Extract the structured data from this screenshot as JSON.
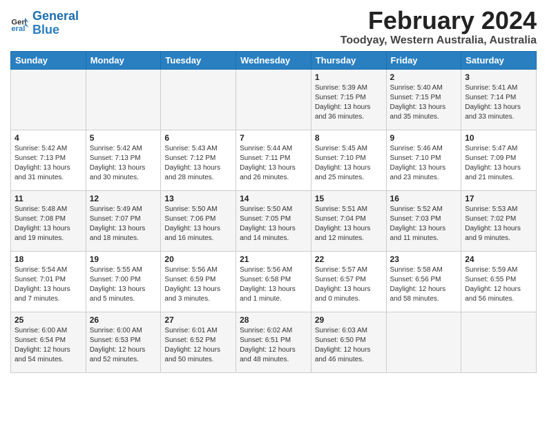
{
  "logo": {
    "text_general": "General",
    "text_blue": "Blue"
  },
  "title": "February 2024",
  "location": "Toodyay, Western Australia, Australia",
  "headers": [
    "Sunday",
    "Monday",
    "Tuesday",
    "Wednesday",
    "Thursday",
    "Friday",
    "Saturday"
  ],
  "weeks": [
    [
      {
        "day": "",
        "content": ""
      },
      {
        "day": "",
        "content": ""
      },
      {
        "day": "",
        "content": ""
      },
      {
        "day": "",
        "content": ""
      },
      {
        "day": "1",
        "content": "Sunrise: 5:39 AM\nSunset: 7:15 PM\nDaylight: 13 hours\nand 36 minutes."
      },
      {
        "day": "2",
        "content": "Sunrise: 5:40 AM\nSunset: 7:15 PM\nDaylight: 13 hours\nand 35 minutes."
      },
      {
        "day": "3",
        "content": "Sunrise: 5:41 AM\nSunset: 7:14 PM\nDaylight: 13 hours\nand 33 minutes."
      }
    ],
    [
      {
        "day": "4",
        "content": "Sunrise: 5:42 AM\nSunset: 7:13 PM\nDaylight: 13 hours\nand 31 minutes."
      },
      {
        "day": "5",
        "content": "Sunrise: 5:42 AM\nSunset: 7:13 PM\nDaylight: 13 hours\nand 30 minutes."
      },
      {
        "day": "6",
        "content": "Sunrise: 5:43 AM\nSunset: 7:12 PM\nDaylight: 13 hours\nand 28 minutes."
      },
      {
        "day": "7",
        "content": "Sunrise: 5:44 AM\nSunset: 7:11 PM\nDaylight: 13 hours\nand 26 minutes."
      },
      {
        "day": "8",
        "content": "Sunrise: 5:45 AM\nSunset: 7:10 PM\nDaylight: 13 hours\nand 25 minutes."
      },
      {
        "day": "9",
        "content": "Sunrise: 5:46 AM\nSunset: 7:10 PM\nDaylight: 13 hours\nand 23 minutes."
      },
      {
        "day": "10",
        "content": "Sunrise: 5:47 AM\nSunset: 7:09 PM\nDaylight: 13 hours\nand 21 minutes."
      }
    ],
    [
      {
        "day": "11",
        "content": "Sunrise: 5:48 AM\nSunset: 7:08 PM\nDaylight: 13 hours\nand 19 minutes."
      },
      {
        "day": "12",
        "content": "Sunrise: 5:49 AM\nSunset: 7:07 PM\nDaylight: 13 hours\nand 18 minutes."
      },
      {
        "day": "13",
        "content": "Sunrise: 5:50 AM\nSunset: 7:06 PM\nDaylight: 13 hours\nand 16 minutes."
      },
      {
        "day": "14",
        "content": "Sunrise: 5:50 AM\nSunset: 7:05 PM\nDaylight: 13 hours\nand 14 minutes."
      },
      {
        "day": "15",
        "content": "Sunrise: 5:51 AM\nSunset: 7:04 PM\nDaylight: 13 hours\nand 12 minutes."
      },
      {
        "day": "16",
        "content": "Sunrise: 5:52 AM\nSunset: 7:03 PM\nDaylight: 13 hours\nand 11 minutes."
      },
      {
        "day": "17",
        "content": "Sunrise: 5:53 AM\nSunset: 7:02 PM\nDaylight: 13 hours\nand 9 minutes."
      }
    ],
    [
      {
        "day": "18",
        "content": "Sunrise: 5:54 AM\nSunset: 7:01 PM\nDaylight: 13 hours\nand 7 minutes."
      },
      {
        "day": "19",
        "content": "Sunrise: 5:55 AM\nSunset: 7:00 PM\nDaylight: 13 hours\nand 5 minutes."
      },
      {
        "day": "20",
        "content": "Sunrise: 5:56 AM\nSunset: 6:59 PM\nDaylight: 13 hours\nand 3 minutes."
      },
      {
        "day": "21",
        "content": "Sunrise: 5:56 AM\nSunset: 6:58 PM\nDaylight: 13 hours\nand 1 minute."
      },
      {
        "day": "22",
        "content": "Sunrise: 5:57 AM\nSunset: 6:57 PM\nDaylight: 13 hours\nand 0 minutes."
      },
      {
        "day": "23",
        "content": "Sunrise: 5:58 AM\nSunset: 6:56 PM\nDaylight: 12 hours\nand 58 minutes."
      },
      {
        "day": "24",
        "content": "Sunrise: 5:59 AM\nSunset: 6:55 PM\nDaylight: 12 hours\nand 56 minutes."
      }
    ],
    [
      {
        "day": "25",
        "content": "Sunrise: 6:00 AM\nSunset: 6:54 PM\nDaylight: 12 hours\nand 54 minutes."
      },
      {
        "day": "26",
        "content": "Sunrise: 6:00 AM\nSunset: 6:53 PM\nDaylight: 12 hours\nand 52 minutes."
      },
      {
        "day": "27",
        "content": "Sunrise: 6:01 AM\nSunset: 6:52 PM\nDaylight: 12 hours\nand 50 minutes."
      },
      {
        "day": "28",
        "content": "Sunrise: 6:02 AM\nSunset: 6:51 PM\nDaylight: 12 hours\nand 48 minutes."
      },
      {
        "day": "29",
        "content": "Sunrise: 6:03 AM\nSunset: 6:50 PM\nDaylight: 12 hours\nand 46 minutes."
      },
      {
        "day": "",
        "content": ""
      },
      {
        "day": "",
        "content": ""
      }
    ]
  ]
}
